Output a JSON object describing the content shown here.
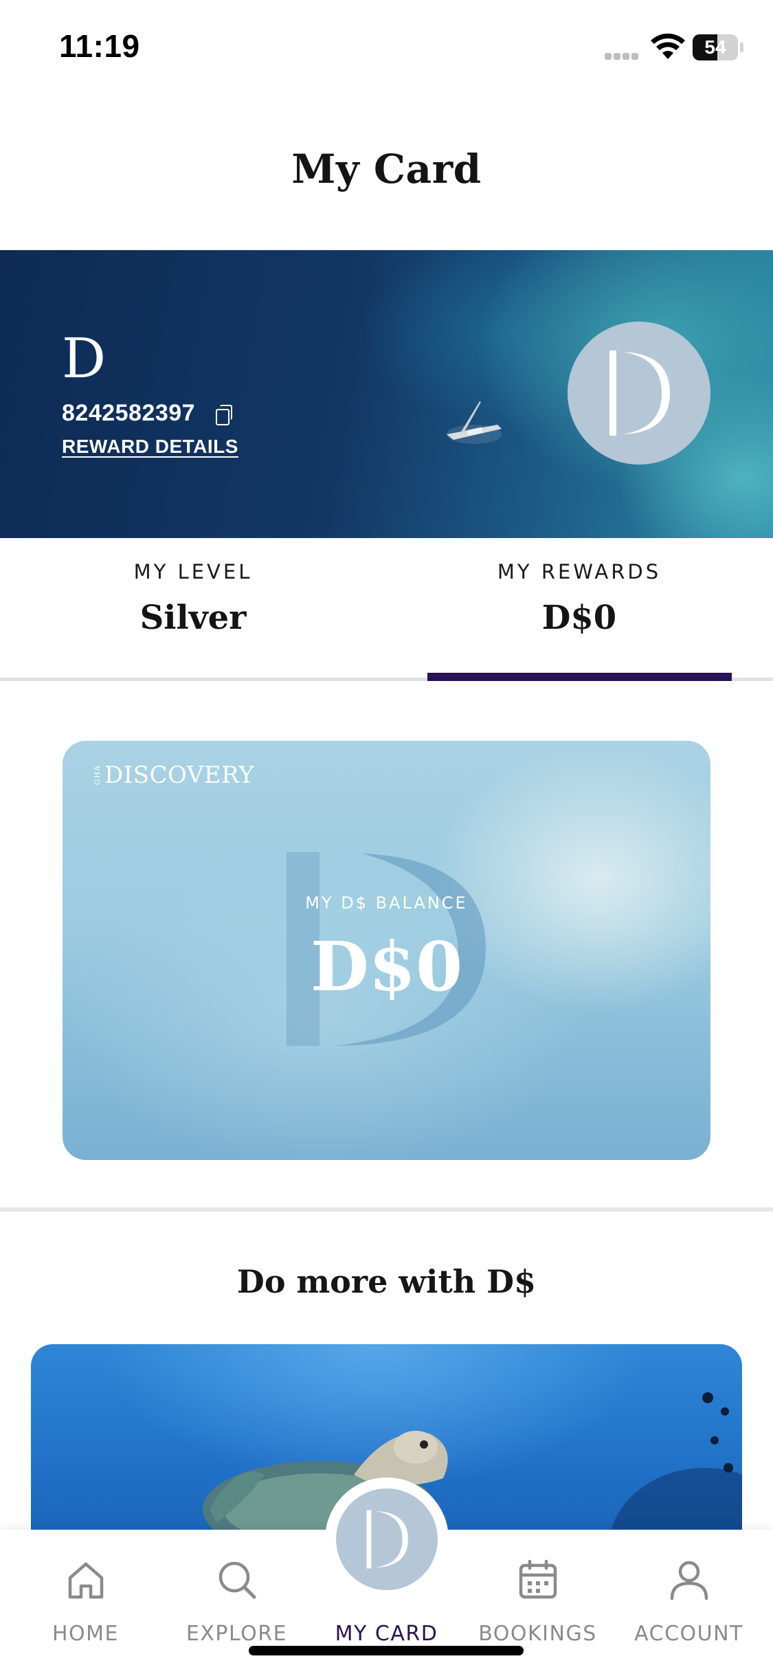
{
  "status_bar": {
    "time": "11:19",
    "battery_level": "54",
    "battery_fraction": 0.54
  },
  "header": {
    "title": "My Card"
  },
  "hero": {
    "logo_letter": "D",
    "member_number": "8242582397",
    "reward_details_label": "REWARD DETAILS",
    "copy_icon": "copy-icon"
  },
  "stats": {
    "level_label": "MY LEVEL",
    "level_value": "Silver",
    "rewards_label": "MY REWARDS",
    "rewards_value": "D$0",
    "selected_tab": "MY REWARDS"
  },
  "balance_card": {
    "brand_prefix": "GHA",
    "brand": "DISCOVERY",
    "label": "MY D$ BALANCE",
    "value": "D$0"
  },
  "section": {
    "title": "Do more with D$"
  },
  "bottom_nav": {
    "items": [
      {
        "label": "HOME",
        "icon": "home-icon"
      },
      {
        "label": "EXPLORE",
        "icon": "search-icon"
      },
      {
        "label": "MY CARD",
        "icon": "card-logo-icon"
      },
      {
        "label": "BOOKINGS",
        "icon": "calendar-icon"
      },
      {
        "label": "ACCOUNT",
        "icon": "user-icon"
      }
    ],
    "active": "MY CARD"
  },
  "colors": {
    "accent": "#2a1254",
    "logo_circle": "#b5c6d6",
    "nav_inactive": "#8a8a8a"
  }
}
